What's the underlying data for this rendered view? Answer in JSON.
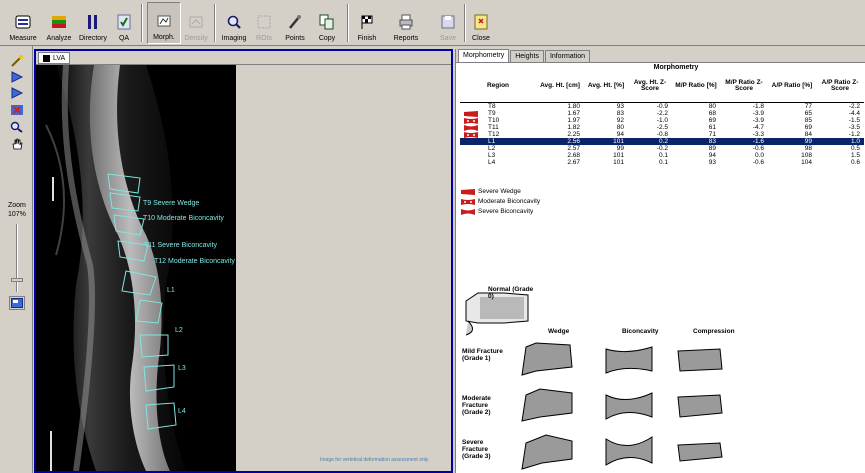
{
  "toolbar": {
    "buttons": [
      {
        "label": "Measure",
        "icon": "measure-icon",
        "enabled": true
      },
      {
        "label": "Analyze",
        "icon": "analyze-icon",
        "enabled": true
      },
      {
        "label": "Directory",
        "icon": "directory-icon",
        "enabled": true
      },
      {
        "label": "QA",
        "icon": "qa-icon",
        "enabled": true
      },
      {
        "label": "Morph.",
        "icon": "morph-icon",
        "enabled": true
      },
      {
        "label": "Density",
        "icon": "density-icon",
        "enabled": false
      },
      {
        "label": "Imaging",
        "icon": "imaging-icon",
        "enabled": true
      },
      {
        "label": "ROIs",
        "icon": "rois-icon",
        "enabled": false
      },
      {
        "label": "Points",
        "icon": "points-icon",
        "enabled": true
      },
      {
        "label": "Copy",
        "icon": "copy-icon",
        "enabled": true
      },
      {
        "label": "Finish",
        "icon": "finish-icon",
        "enabled": true
      },
      {
        "label": "Reports",
        "icon": "reports-icon",
        "enabled": true
      },
      {
        "label": "Save",
        "icon": "save-icon",
        "enabled": false
      },
      {
        "label": "Close",
        "icon": "close-icon",
        "enabled": true
      }
    ]
  },
  "left_tools": {
    "zoom_label": "Zoom",
    "zoom_value": "107%"
  },
  "image_panel": {
    "tab_label": "LVA",
    "note": "Image for vertebral deformation assessment only",
    "labels": [
      {
        "text": "T9 Severe Wedge"
      },
      {
        "text": "T10 Moderate Biconcavity"
      },
      {
        "text": "T11 Severe Biconcavity"
      },
      {
        "text": "T12 Moderate Biconcavity"
      },
      {
        "text": "L1"
      },
      {
        "text": "L2"
      },
      {
        "text": "L3"
      },
      {
        "text": "L4"
      }
    ]
  },
  "results": {
    "tabs": [
      "Morphometry",
      "Heights",
      "Information"
    ],
    "active_tab": "Morphometry",
    "section_title": "Morphometry",
    "columns": [
      "Region",
      "Avg. Ht. [cm]",
      "Avg. Ht. [%]",
      "Avg. Ht. Z-Score",
      "M/P Ratio [%]",
      "M/P Ratio Z-Score",
      "A/P Ratio [%]",
      "A/P Ratio Z-Score"
    ],
    "rows": [
      {
        "region": "T8",
        "marker": "",
        "cells": [
          "1.80",
          "93",
          "-0.9",
          "80",
          "-1.8",
          "77",
          "-2.2"
        ]
      },
      {
        "region": "T9",
        "marker": "wedge",
        "cells": [
          "1.67",
          "83",
          "-2.2",
          "68",
          "-3.9",
          "65",
          "-4.4"
        ]
      },
      {
        "region": "T10",
        "marker": "moderate-biconcavity",
        "cells": [
          "1.97",
          "92",
          "-1.0",
          "69",
          "-3.9",
          "85",
          "-1.5"
        ]
      },
      {
        "region": "T11",
        "marker": "severe-biconcavity",
        "cells": [
          "1.82",
          "80",
          "-2.5",
          "61",
          "-4.7",
          "69",
          "-3.5"
        ]
      },
      {
        "region": "T12",
        "marker": "moderate-biconcavity",
        "cells": [
          "2.25",
          "94",
          "-0.8",
          "71",
          "-3.3",
          "84",
          "-1.2"
        ]
      },
      {
        "region": "L1",
        "marker": "",
        "selected": true,
        "cells": [
          "2.56",
          "101",
          "0.2",
          "83",
          "-1.6",
          "99",
          "1.0"
        ]
      },
      {
        "region": "L2",
        "marker": "",
        "cells": [
          "2.57",
          "99",
          "-0.2",
          "89",
          "-0.6",
          "98",
          "0.5"
        ]
      },
      {
        "region": "L3",
        "marker": "",
        "cells": [
          "2.68",
          "101",
          "0.1",
          "94",
          "0.0",
          "108",
          "1.5"
        ]
      },
      {
        "region": "L4",
        "marker": "",
        "cells": [
          "2.67",
          "101",
          "0.1",
          "93",
          "-0.6",
          "104",
          "0.6"
        ]
      }
    ],
    "legend": [
      {
        "label": "Severe Wedge",
        "marker": "wedge"
      },
      {
        "label": "Moderate Biconcavity",
        "marker": "moderate-biconcavity"
      },
      {
        "label": "Severe Biconcavity",
        "marker": "severe-biconcavity"
      }
    ],
    "grading": {
      "normal_label": "Normal (Grade 0)",
      "columns": [
        "Wedge",
        "Biconcavity",
        "Compression"
      ],
      "rows": [
        "Mild Fracture (Grade 1)",
        "Moderate Fracture (Grade 2)",
        "Severe Fracture (Grade 3)"
      ]
    }
  },
  "colors": {
    "accent_selected_row": "#0a246a",
    "annotation": "#7fe6e0",
    "marker_red": "#cc1b1b",
    "panel_border": "#0000a8"
  }
}
